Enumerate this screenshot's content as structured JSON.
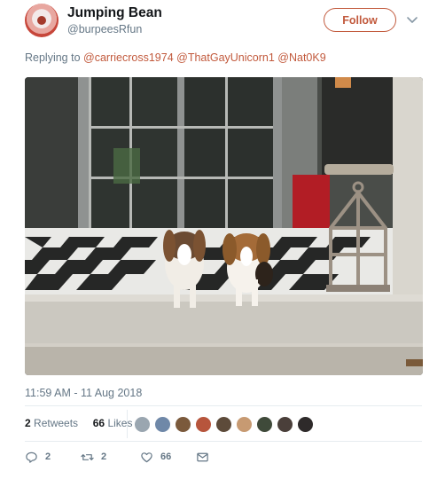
{
  "tweet": {
    "author_name": "Jumping Bean",
    "author_handle": "@burpeesRfun",
    "follow_label": "Follow",
    "replying_prefix": "Replying to",
    "mentions": [
      "@carriecross1974",
      "@ThatGayUnicorn1",
      "@Nat0K9"
    ],
    "timestamp": "11:59 AM - 11 Aug 2018",
    "retweets_count": "2",
    "retweets_label": "Retweets",
    "likes_count": "66",
    "likes_label": "Likes",
    "likers_avatar_colors": [
      "#9aa6b0",
      "#6f88a8",
      "#7b5a3c",
      "#b7553c",
      "#5d4b3a",
      "#c79a72",
      "#3f4a3a",
      "#4a3f3a",
      "#2e2a2a"
    ],
    "actions": {
      "reply_count": "2",
      "retweet_count": "2",
      "like_count": "66"
    },
    "accent_color": "#c25a3d"
  }
}
